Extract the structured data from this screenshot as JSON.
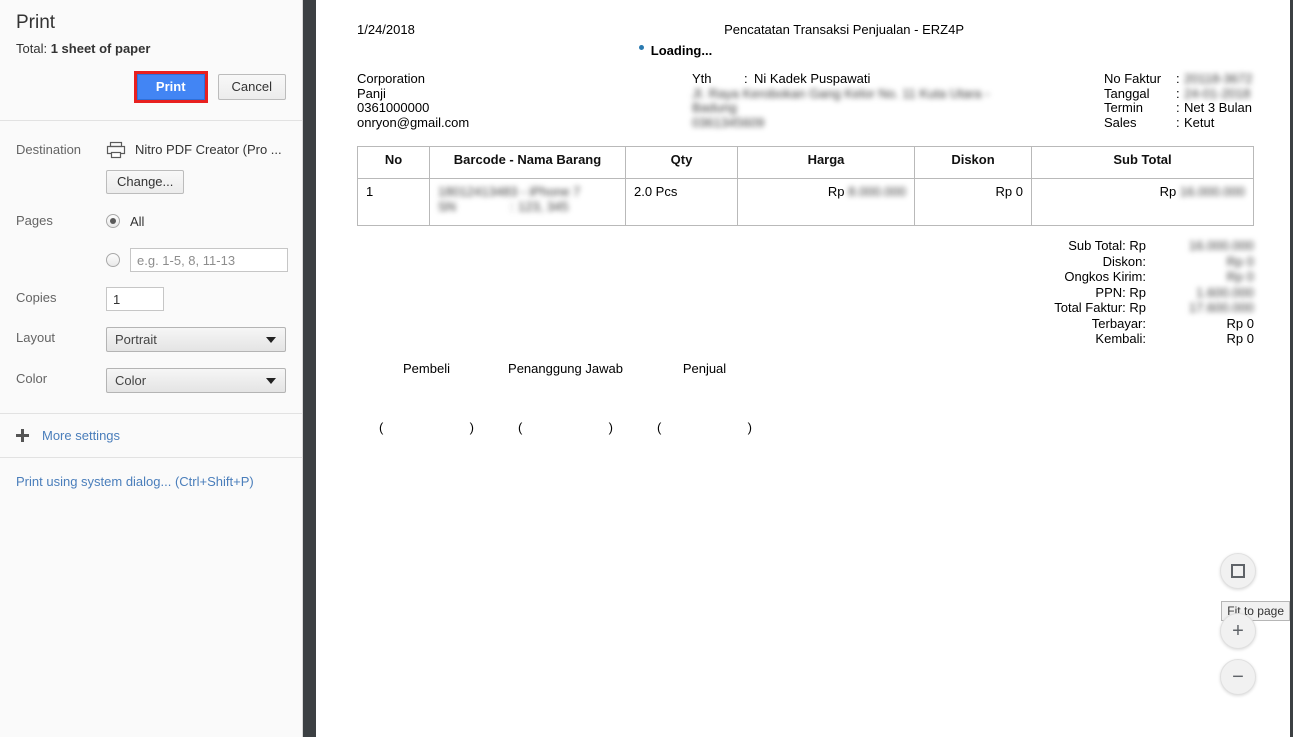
{
  "sidebar": {
    "title": "Print",
    "total_prefix": "Total:",
    "total_value": "1 sheet of paper",
    "print_label": "Print",
    "cancel_label": "Cancel",
    "destination_label": "Destination",
    "destination_value": "Nitro PDF Creator (Pro ...",
    "change_label": "Change...",
    "pages_label": "Pages",
    "pages_all_label": "All",
    "pages_range_placeholder": "e.g. 1-5, 8, 11-13",
    "pages_range_value": "",
    "copies_label": "Copies",
    "copies_value": "1",
    "layout_label": "Layout",
    "layout_value": "Portrait",
    "color_label": "Color",
    "color_value": "Color",
    "more_settings_label": "More settings",
    "system_dialog_label": "Print using system dialog... (Ctrl+Shift+P)",
    "accent_color": "#4285f4",
    "highlight_color": "#e8201f",
    "link_color": "#4a7ebb"
  },
  "document": {
    "date": "1/24/2018",
    "title": "Pencatatan Transaksi Penjualan - ERZ4P",
    "loading_text": "Loading...",
    "company": {
      "name": "Corporation",
      "line2": "Panji",
      "phone": "0361000000",
      "email": "onryon@gmail.com"
    },
    "recipient": {
      "label": "Yth",
      "separator": ":",
      "name": "Ni Kadek Puspawati",
      "address_line1": "Jl. Raya Kerobokan Gang Kelor No. 11 Kuta Utara -",
      "address_line2": "Badung",
      "phone": "0361345609"
    },
    "invoice_meta": [
      {
        "label": "No Faktur",
        "separator": ":",
        "value": "20118-3672",
        "blurred": true
      },
      {
        "label": "Tanggal",
        "separator": ":",
        "value": "24-01-2018",
        "blurred": true
      },
      {
        "label": "Termin",
        "separator": ":",
        "value": "Net 3 Bulan",
        "blurred": false
      },
      {
        "label": "Sales",
        "separator": ":",
        "value": "Ketut",
        "blurred": false
      }
    ],
    "table": {
      "headers": [
        "No",
        "Barcode - Nama Barang",
        "Qty",
        "Harga",
        "Diskon",
        "Sub Total"
      ],
      "rows": [
        {
          "no": "1",
          "barcode_name": "18012413483 - iPhone 7",
          "sn_label": "SN",
          "sn_separator": ":",
          "sn_value": "123, 345",
          "qty": "2.0 Pcs",
          "harga_currency": "Rp",
          "harga": "8.000.000",
          "diskon": "Rp 0",
          "subtotal_currency": "Rp",
          "subtotal": "16.000.000"
        }
      ]
    },
    "totals": [
      {
        "label": "Sub Total: Rp",
        "value": "16.000.000",
        "blurred": true
      },
      {
        "label": "Diskon:",
        "value": "Rp 0",
        "blurred": true
      },
      {
        "label": "Ongkos Kirim:",
        "value": "Rp 0",
        "blurred": true
      },
      {
        "label": "PPN: Rp",
        "value": "1.600.000",
        "blurred": true
      },
      {
        "label": "Total Faktur: Rp",
        "value": "17.600.000",
        "blurred": true
      },
      {
        "label": "Terbayar:",
        "value": "Rp 0",
        "blurred": false
      },
      {
        "label": "Kembali:",
        "value": "Rp 0",
        "blurred": false
      }
    ],
    "signatures": [
      {
        "title": "Pembeli",
        "open": "(",
        "close": ")"
      },
      {
        "title": "Penanggung Jawab",
        "open": "(",
        "close": ")"
      },
      {
        "title": "Penjual",
        "open": "(",
        "close": ")"
      }
    ]
  },
  "zoom_controls": {
    "fit_tooltip": "Fit to page",
    "zoom_in_label": "+",
    "zoom_out_label": "−"
  }
}
